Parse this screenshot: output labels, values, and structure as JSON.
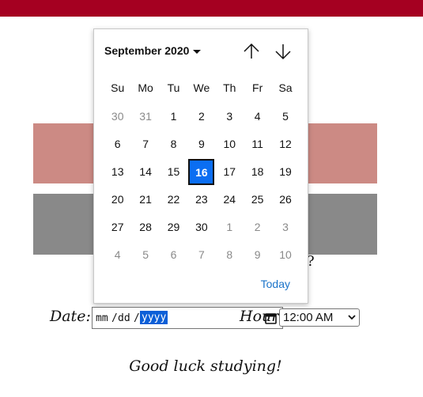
{
  "calendar": {
    "month_label": "September 2020",
    "weekdays": [
      "Su",
      "Mo",
      "Tu",
      "We",
      "Th",
      "Fr",
      "Sa"
    ],
    "weeks": [
      [
        "30",
        "31",
        "1",
        "2",
        "3",
        "4",
        "5"
      ],
      [
        "6",
        "7",
        "8",
        "9",
        "10",
        "11",
        "12"
      ],
      [
        "13",
        "14",
        "15",
        "16",
        "17",
        "18",
        "19"
      ],
      [
        "20",
        "21",
        "22",
        "23",
        "24",
        "25",
        "26"
      ],
      [
        "27",
        "28",
        "29",
        "30",
        "1",
        "2",
        "3"
      ],
      [
        "4",
        "5",
        "6",
        "7",
        "8",
        "9",
        "10"
      ]
    ],
    "selected_day": "16",
    "today_label": "Today"
  },
  "form": {
    "date_label": "Date:",
    "date_mm": "mm",
    "date_sep": "/",
    "date_dd": "dd",
    "date_yyyy": "yyyy",
    "hour_label": "Hour:",
    "hour_value": "12:00 AM"
  },
  "question_tail": "?",
  "footer": "Good luck studying!",
  "colors": {
    "topbar": "#a50021",
    "band_pink": "#cc8a84",
    "band_gray": "#898989",
    "selected_day": "#0b6ef2",
    "today_link": "#1a73c9",
    "yyyy_highlight": "#0b5fd7"
  }
}
